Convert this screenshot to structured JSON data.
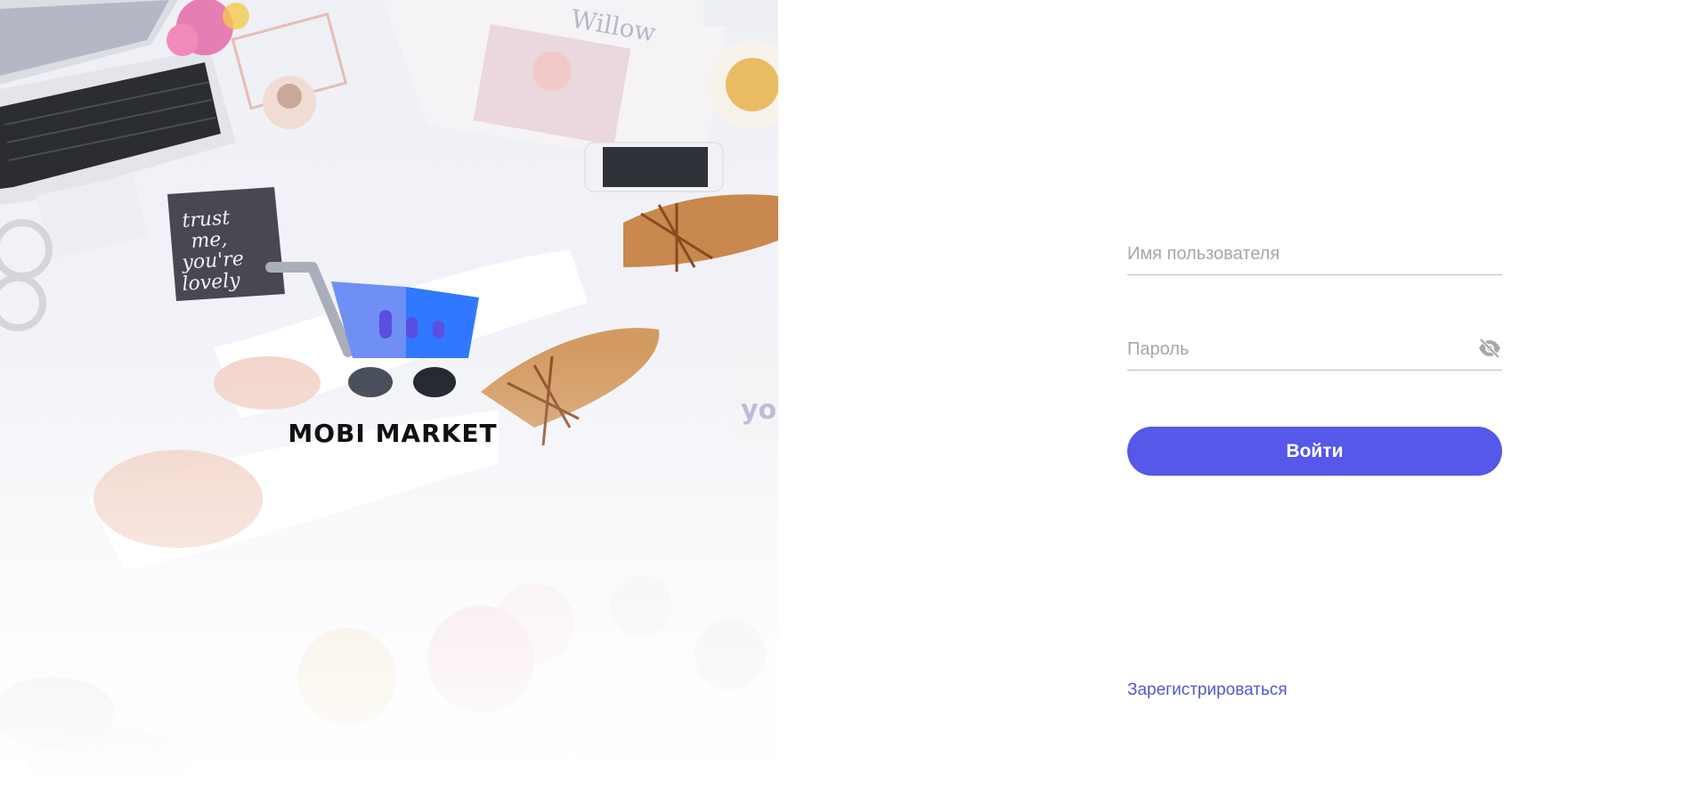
{
  "brand": {
    "name": "MOBI MARKET",
    "cart_colors": {
      "basket_light": "#6f8ff5",
      "basket_dark": "#2f78ff",
      "handle": "#a9aeb8",
      "bars": "#5b4ee0",
      "wheel_left": "#4a4f5c",
      "wheel_right": "#252a33"
    }
  },
  "login": {
    "username_placeholder": "Имя пользователя",
    "password_placeholder": "Пароль",
    "password_toggle_icon": "eye-off-icon",
    "submit_label": "Войти",
    "register_link": "Зарегистрироваться"
  },
  "colors": {
    "accent": "#5558e8",
    "link": "#5558c9",
    "placeholder": "#a6a6ab",
    "underline": "#bdbdc2"
  }
}
